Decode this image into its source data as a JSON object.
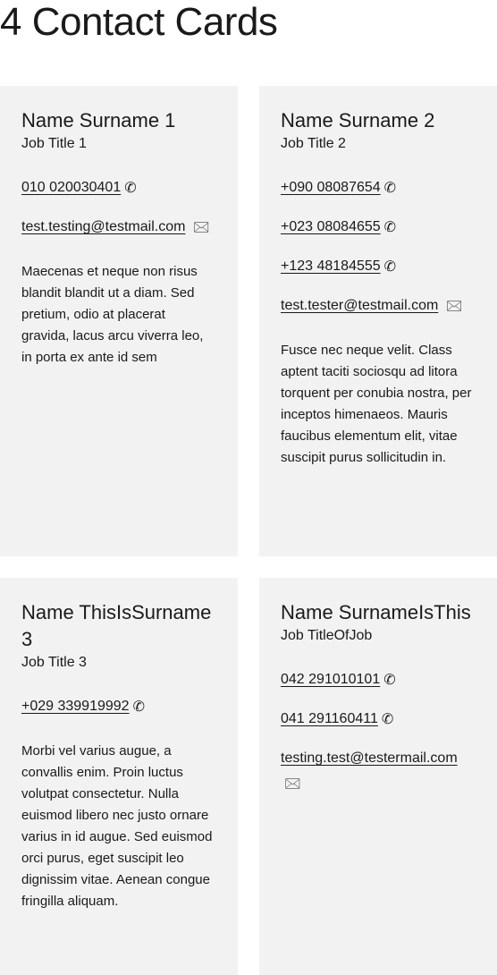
{
  "page": {
    "title": "4 Contact Cards"
  },
  "icons": {
    "phone": "phone-icon",
    "email": "mail-icon"
  },
  "cards": [
    {
      "name": "Name Surname 1",
      "job": "Job Title 1",
      "phones": [
        "010 020030401"
      ],
      "email": "test.testing@testmail.com",
      "description": "Maecenas et neque non risus blandit blandit ut a diam. Sed pretium, odio at placerat gravida, lacus arcu viverra leo, in porta ex ante id sem"
    },
    {
      "name": "Name Surname 2",
      "job": "Job Title 2",
      "phones": [
        "+090 08087654",
        "+023 08084655",
        "+123 48184555"
      ],
      "email": "test.tester@testmail.com",
      "description": "Fusce nec neque velit. Class aptent taciti sociosqu ad litora torquent per conubia nostra, per inceptos himenaeos. Mauris faucibus elementum elit, vitae suscipit purus sollicitudin in."
    },
    {
      "name": "Name ThisIsSurname 3",
      "job": "Job Title 3",
      "phones": [
        "+029 339919992"
      ],
      "email": "",
      "description": "Morbi vel varius augue, a convallis enim. Proin luctus volutpat consectetur. Nulla euismod libero nec justo ornare varius in id augue. Sed euismod orci purus, eget suscipit leo dignissim vitae. Aenean congue fringilla aliquam."
    },
    {
      "name": "Name SurnameIsThis",
      "job": "Job TitleOfJob",
      "phones": [
        "042 291010101",
        "041 291160411"
      ],
      "email": "testing.test@testermail.com",
      "description": ""
    }
  ]
}
